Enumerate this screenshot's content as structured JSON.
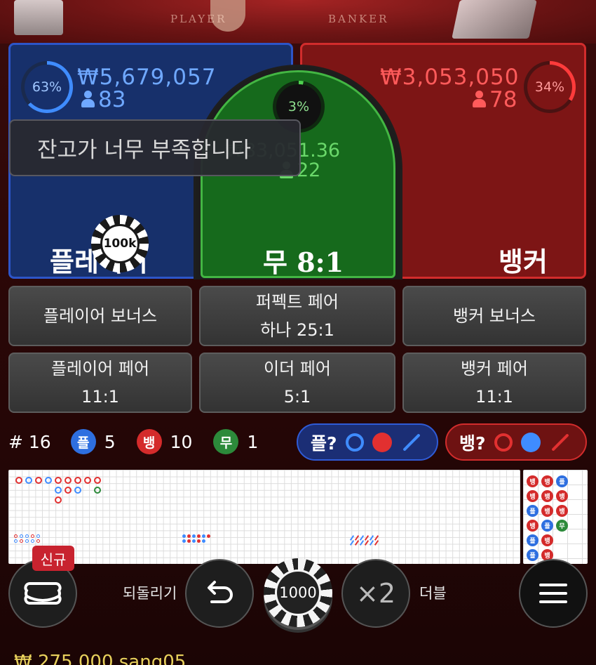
{
  "table": {
    "player_label": "PLAYER",
    "banker_label": "BANKER"
  },
  "player": {
    "percent": "63%",
    "amount": "₩5,679,057",
    "players": "83",
    "label": "플레이어",
    "color": "#2d55c8"
  },
  "banker": {
    "percent": "34%",
    "amount": "₩3,053,050",
    "players": "78",
    "label": "뱅커",
    "color": "#d22c2c"
  },
  "tie": {
    "percent": "3%",
    "amount": "₩83,051.36",
    "players": "22",
    "label": "무 8:1",
    "color": "#43b643"
  },
  "toast": {
    "message": "잔고가 너무 부족합니다"
  },
  "placed_chip": {
    "value": "100k"
  },
  "side_bets": [
    {
      "line1": "플레이어 보너스",
      "line2": ""
    },
    {
      "line1": "퍼펙트 페어",
      "line2": "하나 25:1"
    },
    {
      "line1": "뱅커 보너스",
      "line2": ""
    },
    {
      "line1": "플레이어 페어",
      "line2": "11:1"
    },
    {
      "line1": "이더 페어",
      "line2": "5:1"
    },
    {
      "line1": "뱅커 페어",
      "line2": "11:1"
    }
  ],
  "stats": {
    "rounds": "# 16",
    "player_symbol": "플",
    "player_count": "5",
    "banker_symbol": "뱅",
    "banker_count": "10",
    "tie_symbol": "무",
    "tie_count": "1"
  },
  "predict": {
    "player_label": "플?",
    "banker_label": "뱅?"
  },
  "bead_road": [
    "뱅",
    "뱅",
    "플",
    "뱅",
    "뱅",
    "뱅",
    "플",
    "뱅",
    "뱅",
    "뱅",
    "플",
    "무",
    "플",
    "뱅",
    "",
    "플",
    "뱅",
    ""
  ],
  "controls": {
    "new_badge": "신규",
    "undo_label": "되돌리기",
    "chip_value": "1000",
    "double_symbol": "×2",
    "double_label": "더블"
  },
  "balance": "₩ 275,000 sang05"
}
